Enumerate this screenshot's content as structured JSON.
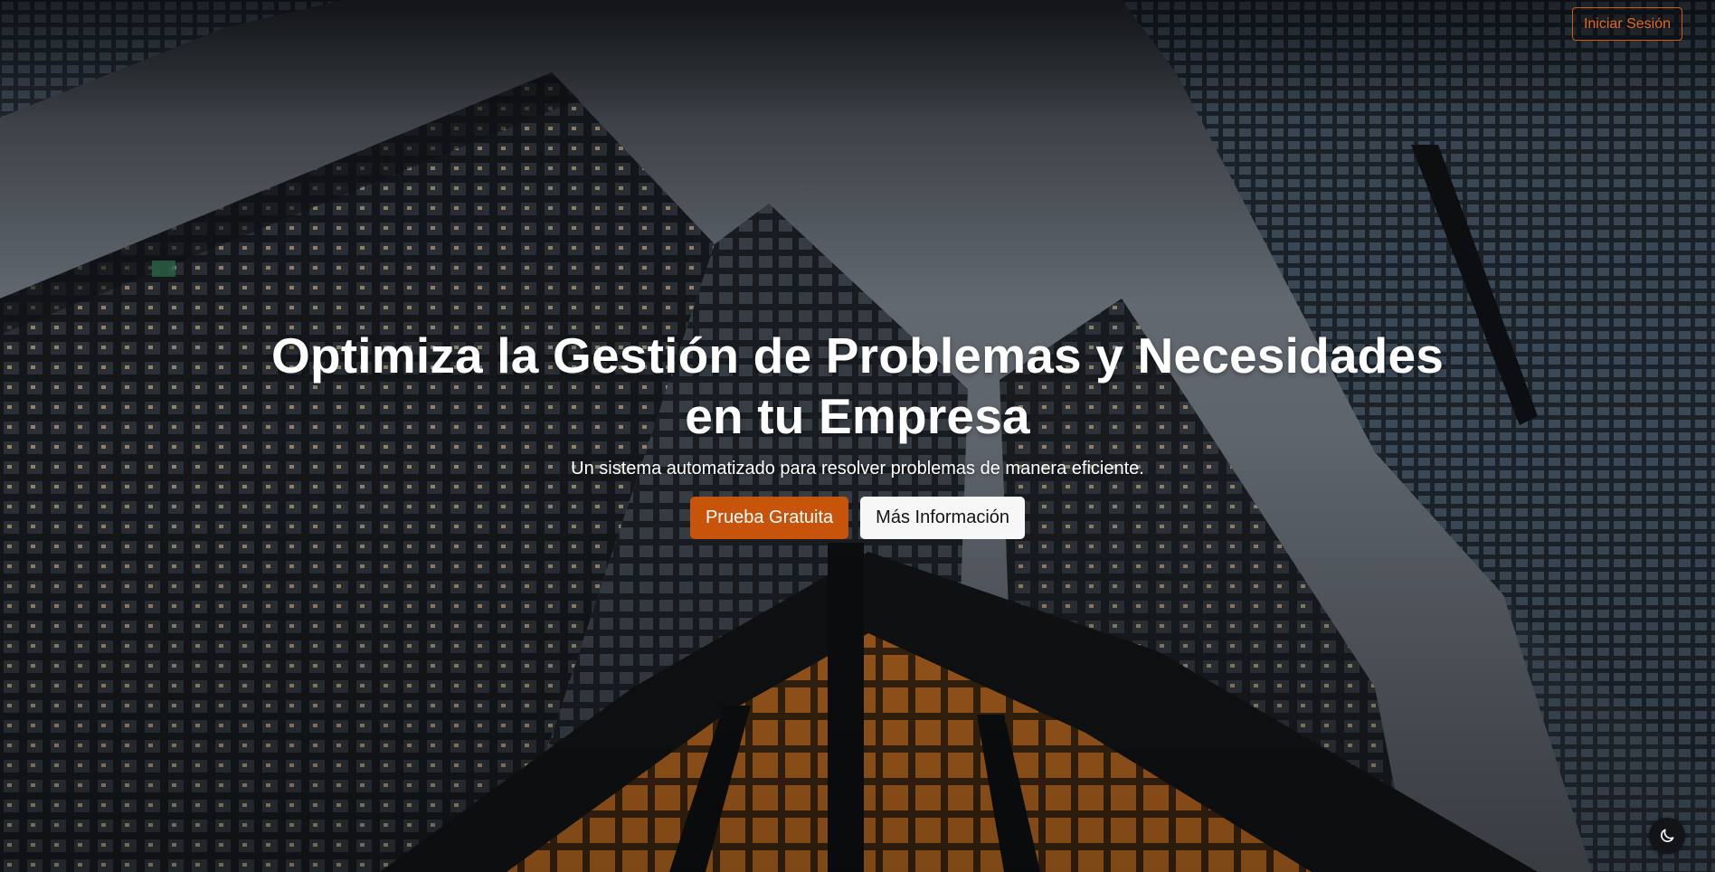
{
  "header": {
    "login_label": "Iniciar Sesión"
  },
  "hero": {
    "title": "Optimiza la Gestión de Problemas y Necesidades en tu Empresa",
    "subtitle": "Un sistema automatizado para resolver problemas de manera eficiente.",
    "primary_cta": "Prueba Gratuita",
    "secondary_cta": "Más Información"
  },
  "theme_toggle": {
    "icon": "moon-icon"
  },
  "colors": {
    "accent": "#c8530b",
    "accent_outline": "#d15a12",
    "secondary_button_bg": "#f7f7f8"
  }
}
